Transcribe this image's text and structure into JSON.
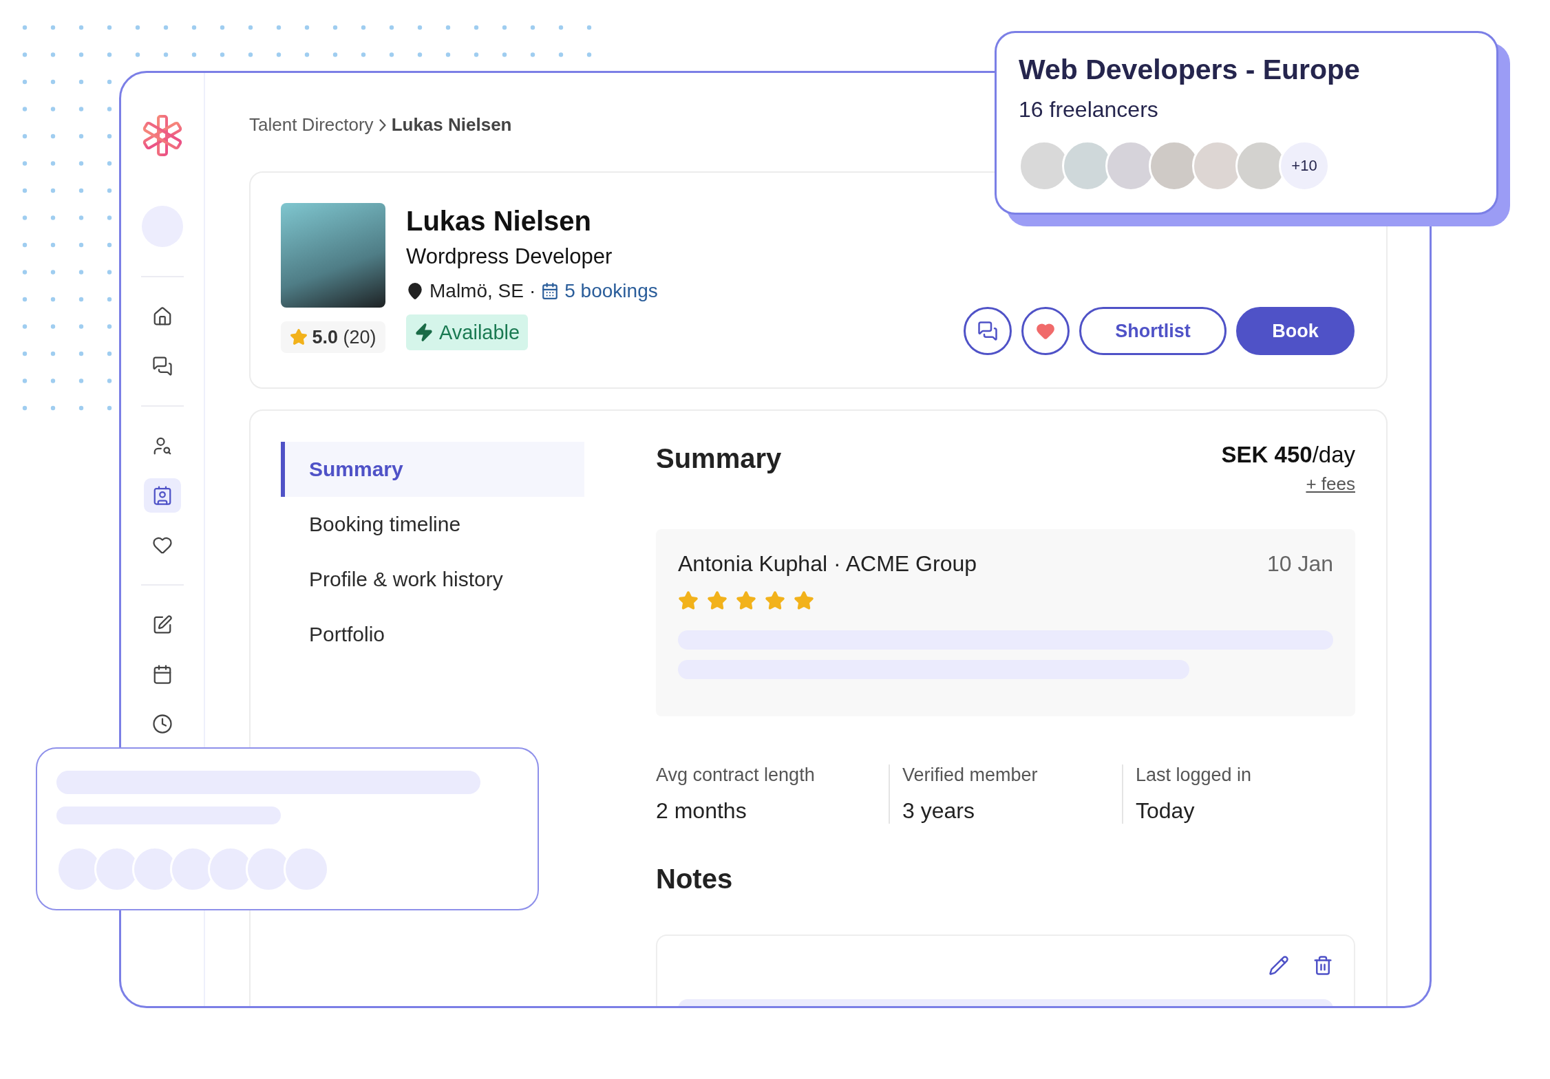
{
  "breadcrumb": [
    {
      "label": "Talent Directory",
      "current": false
    },
    {
      "label": "Lukas Nielsen",
      "current": true
    }
  ],
  "sidebar": {
    "groups": [
      [
        {
          "selected": false
        },
        {
          "selected": false
        }
      ],
      [
        {
          "selected": false
        },
        {
          "selected": true
        },
        {
          "selected": false
        }
      ],
      [
        {
          "selected": false
        },
        {
          "selected": false
        },
        {
          "selected": false
        }
      ]
    ]
  },
  "profile": {
    "name": "Lukas Nielsen",
    "role": "Wordpress Developer",
    "location": "Malmö, SE",
    "separator": "·",
    "bookings": "5 bookings",
    "rating": "**5.0** (20)",
    "status": "Available"
  },
  "actions": [
    {
      "kind": "chat"
    },
    {
      "kind": "favorite",
      "on": true
    },
    {
      "kind": "outline",
      "label": "Shortlist"
    },
    {
      "kind": "primary",
      "label": "Book"
    }
  ],
  "tabs": [
    {
      "label": "Summary",
      "selected": true
    },
    {
      "label": "Booking timeline",
      "selected": false
    },
    {
      "label": "Profile & work history",
      "selected": false
    },
    {
      "label": "Portfolio",
      "selected": false
    }
  ],
  "summary": {
    "title": "Summary",
    "price": "**SEK 450**/day",
    "fees": "+ fees",
    "review": {
      "author": "Antonia Kuphal · ACME Group",
      "date": "10 Jan",
      "stars": 5
    },
    "stats": [
      {
        "label": "Avg contract length",
        "value": "2 months"
      },
      {
        "label": "Verified member",
        "value": "3 years"
      },
      {
        "label": "Last logged in",
        "value": "Today"
      }
    ]
  },
  "notes": {
    "title": "Notes"
  },
  "group_card": {
    "title": "Web Developers - Europe",
    "subtitle": "16 freelancers",
    "avatars": [
      {
        "kind": "photo"
      },
      {
        "kind": "photo"
      },
      {
        "kind": "photo"
      },
      {
        "kind": "photo"
      },
      {
        "kind": "photo"
      },
      {
        "kind": "photo"
      },
      {
        "kind": "more",
        "label": "+10"
      }
    ]
  }
}
